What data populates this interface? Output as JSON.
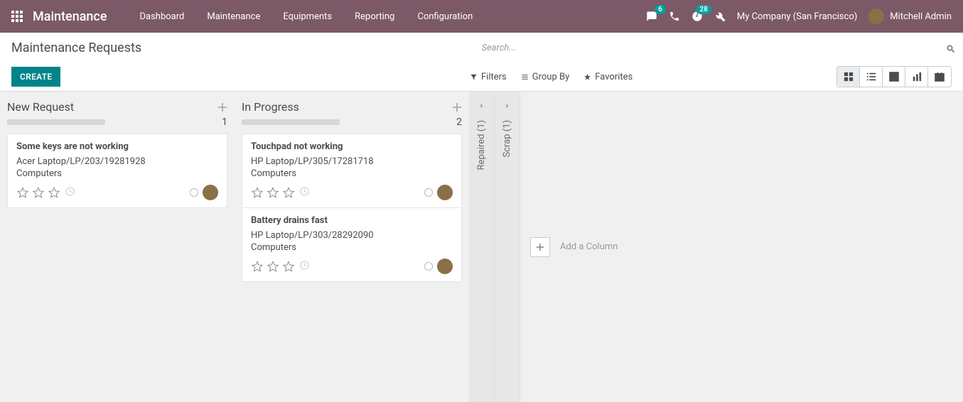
{
  "nav": {
    "brand": "Maintenance",
    "menu": [
      "Dashboard",
      "Maintenance",
      "Equipments",
      "Reporting",
      "Configuration"
    ],
    "badge_chat": "6",
    "badge_activity": "28",
    "company": "My Company (San Francisco)",
    "user": "Mitchell Admin"
  },
  "cp": {
    "title": "Maintenance Requests",
    "create": "CREATE",
    "search_placeholder": "Search...",
    "filters": "Filters",
    "groupby": "Group By",
    "favorites": "Favorites"
  },
  "columns": {
    "new": {
      "title": "New Request",
      "count": "1"
    },
    "inprogress": {
      "title": "In Progress",
      "count": "2"
    },
    "repaired": "Repaired (1)",
    "scrap": "Scrap (1)"
  },
  "cards": {
    "c1": {
      "title": "Some keys are not working",
      "equip": "Acer Laptop/LP/203/19281928",
      "cat": "Computers"
    },
    "c2": {
      "title": "Touchpad not working",
      "equip": "HP Laptop/LP/305/17281718",
      "cat": "Computers"
    },
    "c3": {
      "title": "Battery drains fast",
      "equip": "HP Laptop/LP/303/28292090",
      "cat": "Computers"
    }
  },
  "addcolumn": "Add a Column"
}
